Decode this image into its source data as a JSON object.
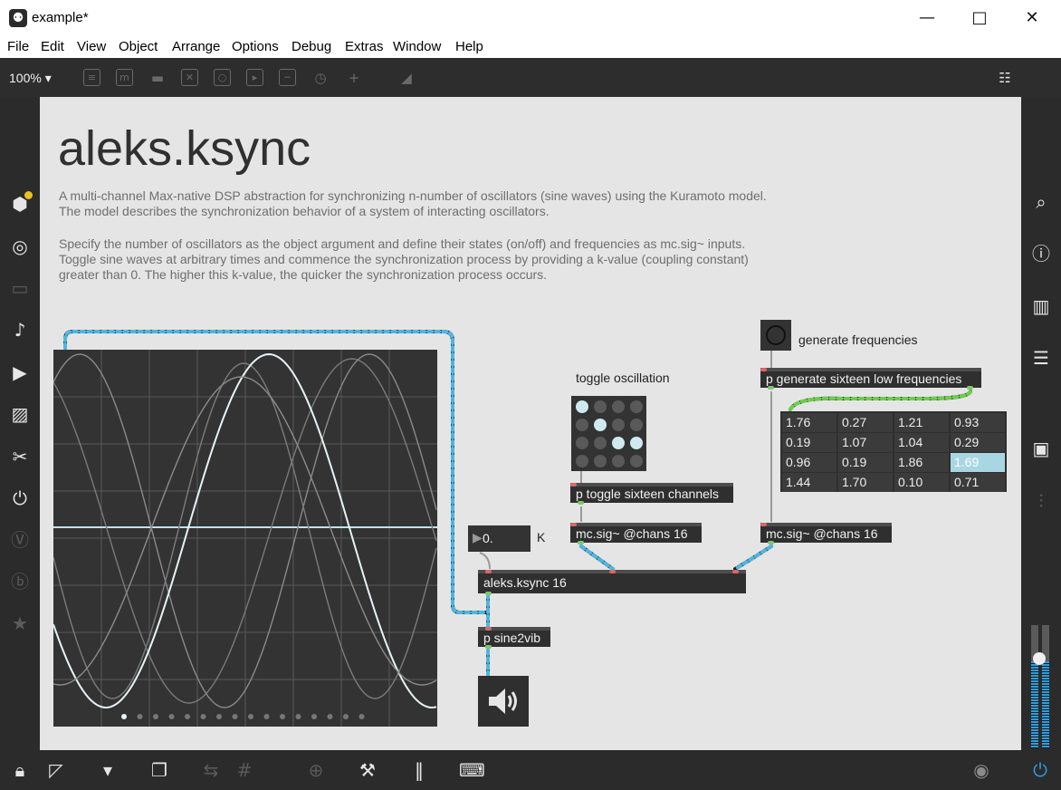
{
  "window": {
    "title": "example*",
    "app_icon": "max-logo-icon"
  },
  "menu": [
    "File",
    "Edit",
    "View",
    "Object",
    "Arrange",
    "Options",
    "Debug",
    "Extras",
    "Window",
    "Help"
  ],
  "toolbar": {
    "zoom": "100%"
  },
  "patcher": {
    "title": "aleks.ksync",
    "desc1": "A multi-channel Max-native DSP abstraction for synchronizing n-number of oscillators (sine waves) using the Kuramoto model. The model describes the synchronization behavior of a system of interacting oscillators.",
    "desc2": "Specify the number of oscillators as the object argument and define their states (on/off) and frequencies as mc.sig~ inputs. Toggle sine waves at arbitrary times and commence the synchronization process by providing a k-value (coupling constant) greater than 0. The higher this k-value, the quicker the synchronization process occurs.",
    "labels": {
      "toggle": "toggle oscillation",
      "generate": "generate frequencies",
      "k": "K"
    },
    "objects": {
      "toggle_sixteen": "p toggle sixteen channels",
      "generate_sixteen": "p generate sixteen low frequencies",
      "mcsig_left": "mc.sig~ @chans 16",
      "mcsig_right": "mc.sig~ @chans 16",
      "ksync": "aleks.ksync 16",
      "sine2vib": "p sine2vib"
    },
    "number_box": "0.",
    "matrix": [
      [
        1,
        0,
        0,
        0
      ],
      [
        0,
        1,
        0,
        0
      ],
      [
        0,
        0,
        1,
        1
      ],
      [
        0,
        0,
        0,
        0
      ]
    ],
    "table": [
      [
        "1.76",
        "0.27",
        "1.21",
        "0.93"
      ],
      [
        "0.19",
        "1.07",
        "1.04",
        "0.29"
      ],
      [
        "0.96",
        "0.19",
        "1.86",
        "1.69"
      ],
      [
        "1.44",
        "1.70",
        "0.10",
        "0.71"
      ]
    ],
    "selected_cell": [
      2,
      3
    ],
    "scope_dots": 16,
    "colors": {
      "patch_cord": "#4fb6e0",
      "canvas": "#e5e5e5",
      "object": "#2f2f2f",
      "selected": "#a9d6e3"
    }
  }
}
